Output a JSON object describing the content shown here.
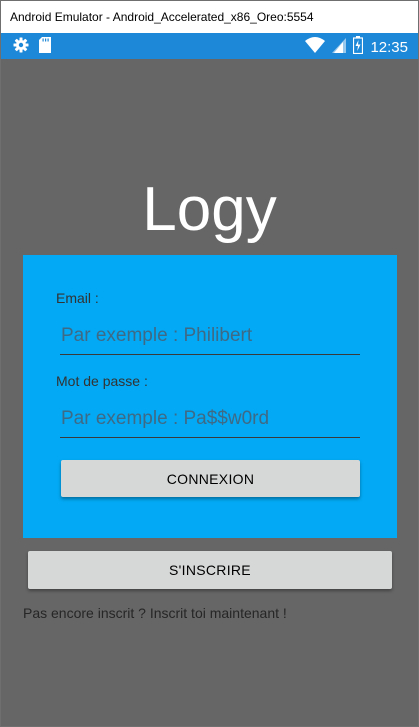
{
  "window": {
    "title": "Android Emulator - Android_Accelerated_x86_Oreo:5554"
  },
  "status_bar": {
    "time": "12:35",
    "left_icons": [
      "gear-icon",
      "sd-card-icon"
    ],
    "right_icons": [
      "wifi-icon",
      "cell-signal-icon",
      "battery-icon"
    ],
    "color": "#1e88d8"
  },
  "app": {
    "logo": "Logy",
    "background": "#666666",
    "panel_color": "#03a9f4",
    "login": {
      "email_label": "Email :",
      "email_placeholder": "Par exemple : Philibert",
      "password_label": "Mot de passe :",
      "password_placeholder": "Par exemple : Pa$$w0rd",
      "connect_label": "CONNEXION"
    },
    "register_label": "S'INSCRIRE",
    "register_note": "Pas encore inscrit ? Inscrit toi maintenant !"
  }
}
